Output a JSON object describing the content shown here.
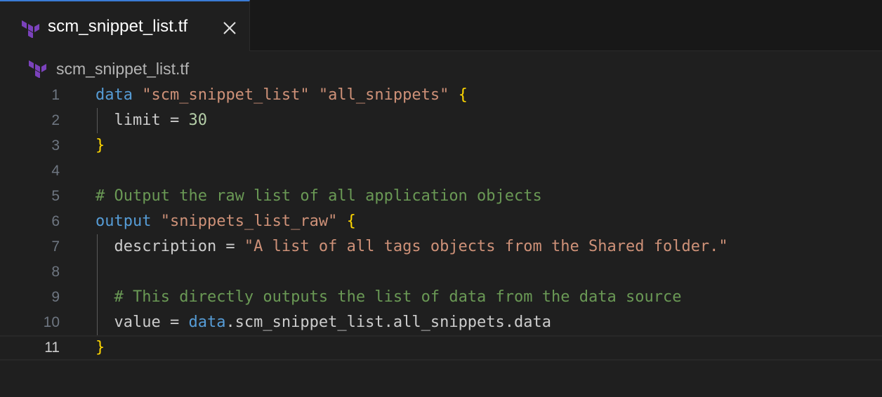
{
  "tab": {
    "filename": "scm_snippet_list.tf",
    "icon": "terraform-icon",
    "close_icon": "close-icon"
  },
  "breadcrumb": {
    "filename": "scm_snippet_list.tf",
    "icon": "terraform-icon"
  },
  "editor": {
    "active_line": 11,
    "line_numbers": [
      "1",
      "2",
      "3",
      "4",
      "5",
      "6",
      "7",
      "8",
      "9",
      "10",
      "11"
    ],
    "lines": [
      [
        {
          "t": "kw",
          "v": "data"
        },
        {
          "t": "tx",
          "v": " "
        },
        {
          "t": "str",
          "v": "\"scm_snippet_list\""
        },
        {
          "t": "tx",
          "v": " "
        },
        {
          "t": "str",
          "v": "\"all_snippets\""
        },
        {
          "t": "tx",
          "v": " "
        },
        {
          "t": "br",
          "v": "{"
        }
      ],
      [
        {
          "t": "tx",
          "v": "  limit = "
        },
        {
          "t": "num",
          "v": "30"
        }
      ],
      [
        {
          "t": "br",
          "v": "}"
        }
      ],
      [],
      [
        {
          "t": "cm",
          "v": "# Output the raw list of all application objects"
        }
      ],
      [
        {
          "t": "kw",
          "v": "output"
        },
        {
          "t": "tx",
          "v": " "
        },
        {
          "t": "str",
          "v": "\"snippets_list_raw\""
        },
        {
          "t": "tx",
          "v": " "
        },
        {
          "t": "br",
          "v": "{"
        }
      ],
      [
        {
          "t": "tx",
          "v": "  description = "
        },
        {
          "t": "str",
          "v": "\"A list of all tags objects from the Shared folder.\""
        }
      ],
      [],
      [
        {
          "t": "tx",
          "v": "  "
        },
        {
          "t": "cm",
          "v": "# This directly outputs the list of data from the data source"
        }
      ],
      [
        {
          "t": "tx",
          "v": "  value = "
        },
        {
          "t": "kw",
          "v": "data"
        },
        {
          "t": "tx",
          "v": ".scm_snippet_list.all_snippets.data"
        }
      ],
      [
        {
          "t": "br",
          "v": "}"
        }
      ]
    ]
  },
  "colors": {
    "keyword": "#569cd6",
    "string": "#ce9178",
    "number": "#b5cea8",
    "comment": "#6a9955",
    "bracket": "#ffd700",
    "text": "#cccccc",
    "tab_accent": "#3a7bd5",
    "terraform": "#7b42bc"
  }
}
